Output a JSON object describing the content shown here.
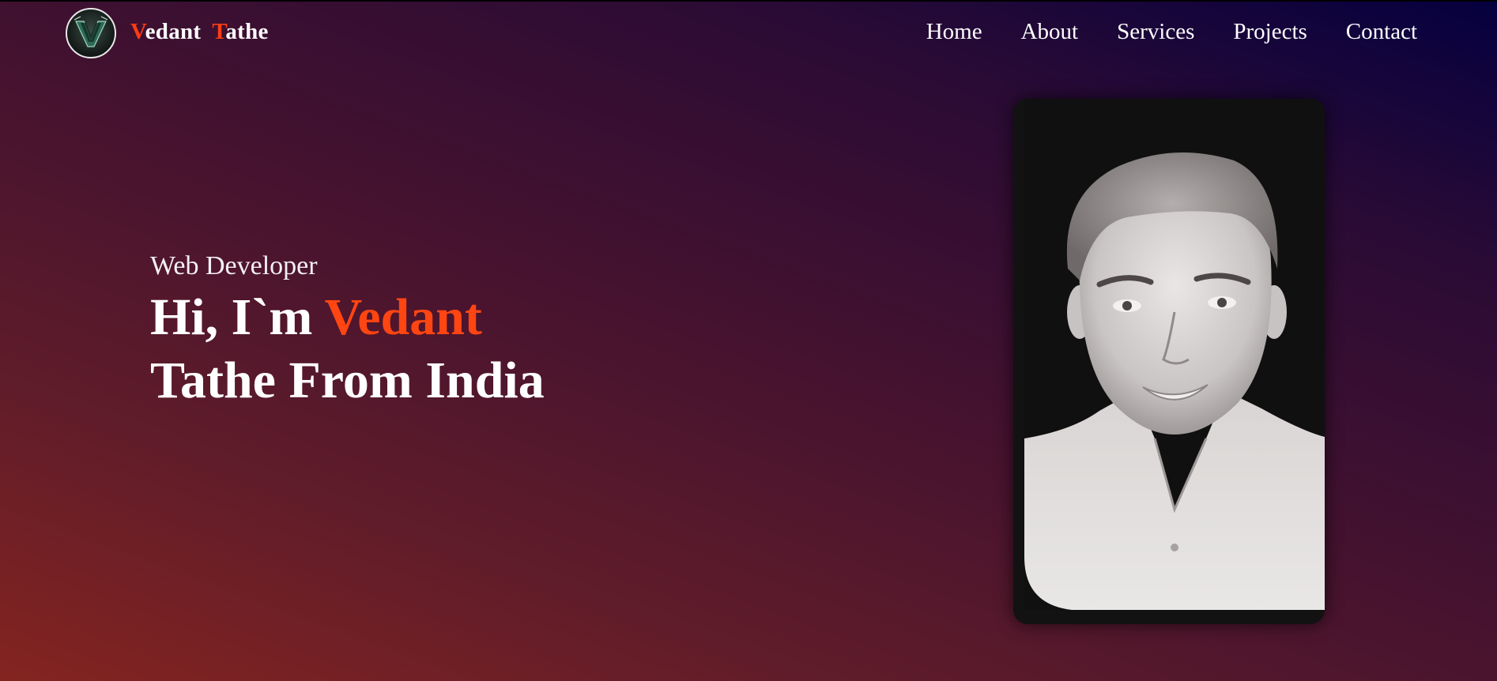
{
  "brand": {
    "first_initial": "V",
    "first_rest": "edant",
    "last_initial": "T",
    "last_rest": "athe",
    "logo_icon": "v-monogram-logo-icon"
  },
  "nav": {
    "items": [
      {
        "label": "Home"
      },
      {
        "label": "About"
      },
      {
        "label": "Services"
      },
      {
        "label": "Projects"
      },
      {
        "label": "Contact"
      }
    ]
  },
  "hero": {
    "role": "Web Developer",
    "greeting": "Hi, I`m ",
    "name_highlight": "Vedant",
    "line2": "Tathe From India"
  },
  "portrait": {
    "icon": "profile-photo"
  },
  "colors": {
    "accent": "#ff3d14",
    "text": "#ffffff",
    "card_bg": "#121212"
  }
}
